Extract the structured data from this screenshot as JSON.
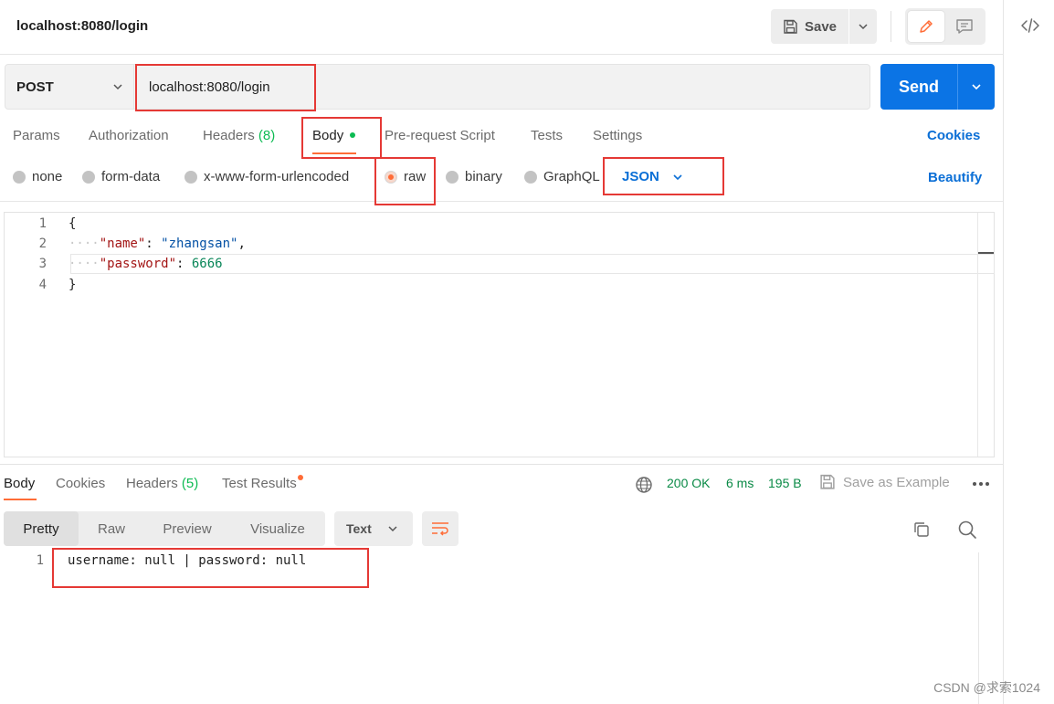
{
  "request": {
    "title": "localhost:8080/login",
    "method": "POST",
    "url": "localhost:8080/login"
  },
  "toolbar": {
    "save_label": "Save",
    "send_label": "Send"
  },
  "request_tabs": {
    "params": "Params",
    "authorization": "Authorization",
    "headers_label": "Headers",
    "headers_count": "(8)",
    "body": "Body",
    "prerequest": "Pre-request Script",
    "tests": "Tests",
    "settings": "Settings",
    "cookies": "Cookies"
  },
  "body_types": {
    "options": [
      "none",
      "form-data",
      "x-www-form-urlencoded",
      "raw",
      "binary",
      "GraphQL"
    ],
    "selected": "raw",
    "language": "JSON",
    "beautify": "Beautify"
  },
  "editor": {
    "line_numbers": [
      "1",
      "2",
      "3",
      "4"
    ],
    "open_brace": "{",
    "close_brace": "}",
    "indent": "····",
    "name_key": "\"name\"",
    "name_value": "\"zhangsan\"",
    "password_key": "\"password\"",
    "password_value": "6666"
  },
  "response": {
    "tabs": {
      "body": "Body",
      "cookies": "Cookies",
      "headers_label": "Headers",
      "headers_count": "(5)",
      "test_results": "Test Results"
    },
    "status": "200 OK",
    "time": "6 ms",
    "size": "195 B",
    "save_example": "Save as Example",
    "views": [
      "Pretty",
      "Raw",
      "Preview",
      "Visualize"
    ],
    "active_view": "Pretty",
    "format": "Text",
    "line_number": "1",
    "content": "username: null | password: null"
  },
  "watermark": "CSDN @求索1024",
  "colors": {
    "accent_orange": "#ff6c37",
    "send_blue": "#0b74e5",
    "link_blue": "#0b6fd6",
    "status_green": "#0a8a46",
    "annotation_red": "#e53935"
  },
  "icons": [
    "save-icon",
    "chevron-down-icon",
    "pencil-icon",
    "comment-icon",
    "code-icon",
    "globe-icon",
    "more-icon",
    "wrap-icon",
    "copy-icon",
    "search-icon"
  ]
}
